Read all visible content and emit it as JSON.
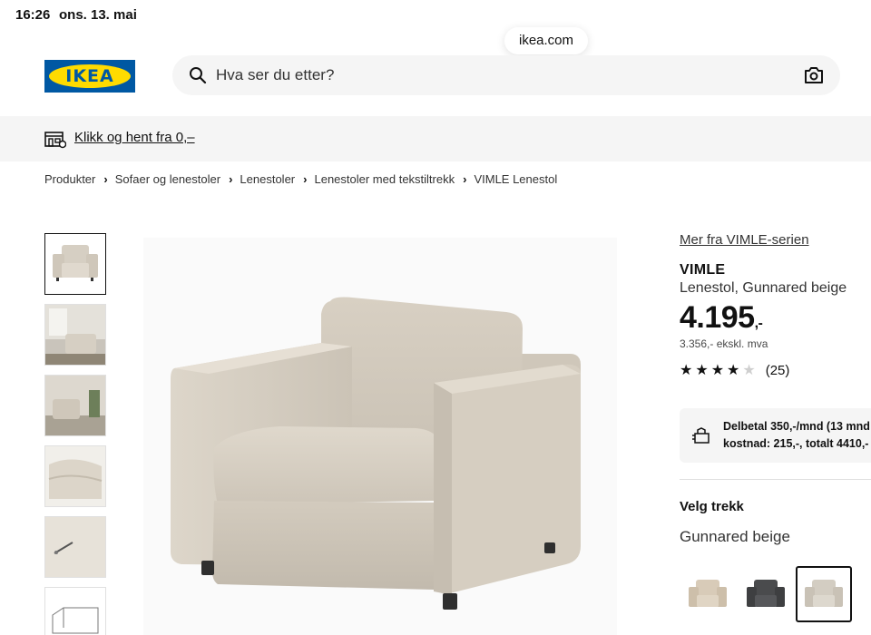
{
  "status_bar": {
    "time": "16:26",
    "date": "ons. 13. mai"
  },
  "browser": {
    "url": "ikea.com"
  },
  "header": {
    "logo_text": "IKEA",
    "search_placeholder": "Hva ser du etter?",
    "search_icon": "magnifier-icon",
    "camera_icon": "camera-icon"
  },
  "promo": {
    "icon": "store-icon",
    "text": "Klikk og hent fra 0,–"
  },
  "breadcrumb": {
    "separator": "›",
    "items": [
      {
        "label": "Produkter"
      },
      {
        "label": "Sofaer og lenestoler"
      },
      {
        "label": "Lenestoler"
      },
      {
        "label": "Lenestoler med tekstiltrekk"
      },
      {
        "label": "VIMLE Lenestol"
      }
    ]
  },
  "gallery": {
    "thumbnail_count": 6,
    "selected_index": 0
  },
  "product": {
    "series_link": "Mer fra VIMLE-serien",
    "name": "VIMLE",
    "description": "Lenestol, Gunnared beige",
    "price": "4.195",
    "price_suffix": ",-",
    "price_ex_vat": "3.356,- ekskl. mva",
    "rating": {
      "stars": 4,
      "max": 5,
      "count": "(25)"
    }
  },
  "financing": {
    "icon": "payment-icon",
    "line1": "Delbetal 350,-/mnd (13 mnd",
    "line2": "kostnad: 215,-, totalt 4410,-"
  },
  "cover_selection": {
    "label": "Velg trekk",
    "selected": "Gunnared beige",
    "swatches": [
      {
        "name": "beige",
        "color": "#d8cbb8"
      },
      {
        "name": "dark-grey",
        "color": "#4a4b4d"
      },
      {
        "name": "light-beige",
        "color": "#d3cdc2"
      }
    ],
    "selected_swatch_index": 2
  },
  "colors": {
    "ikea_blue": "#0058a3",
    "ikea_yellow": "#ffdb00",
    "chair_fabric": "#d9d2c6"
  }
}
